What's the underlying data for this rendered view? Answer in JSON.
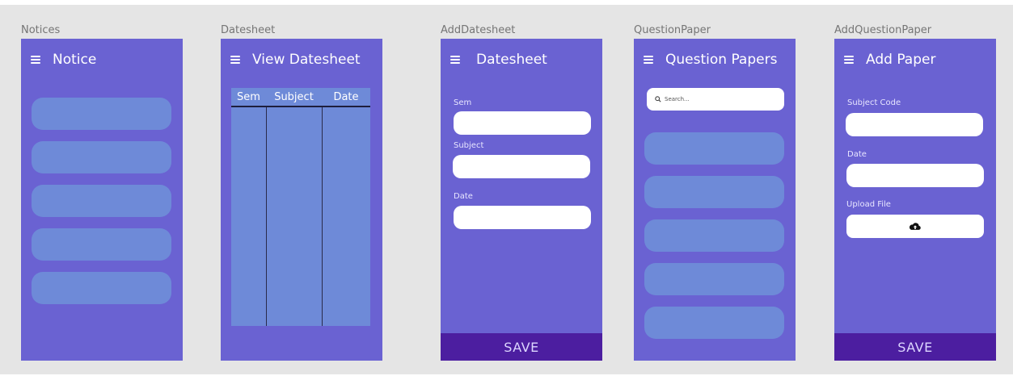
{
  "frames": {
    "notices": {
      "label": "Notices",
      "title": "Notice",
      "cards": 5
    },
    "datesheet": {
      "label": "Datesheet",
      "title": "View Datesheet",
      "columns": [
        "Sem",
        "Subject",
        "Date"
      ]
    },
    "add_datesheet": {
      "label": "AddDatesheet",
      "title": "Datesheet",
      "fields": {
        "sem": "Sem",
        "subject": "Subject",
        "date": "Date"
      },
      "save": "SAVE"
    },
    "question_paper": {
      "label": "QuestionPaper",
      "title": "Question Papers",
      "search_placeholder": "Search...",
      "cards": 5
    },
    "add_question_paper": {
      "label": "AddQuestionPaper",
      "title": "Add Paper",
      "fields": {
        "subject_code": "Subject Code",
        "date": "Date",
        "upload": "Upload File"
      },
      "save": "SAVE"
    }
  },
  "colors": {
    "canvas": "#e5e5e5",
    "frame": "#6a62d2",
    "card": "#6e8ad8",
    "save_bar": "#4c1ea0"
  },
  "icons": [
    "menu-icon",
    "search-icon",
    "cloud-upload-icon"
  ]
}
